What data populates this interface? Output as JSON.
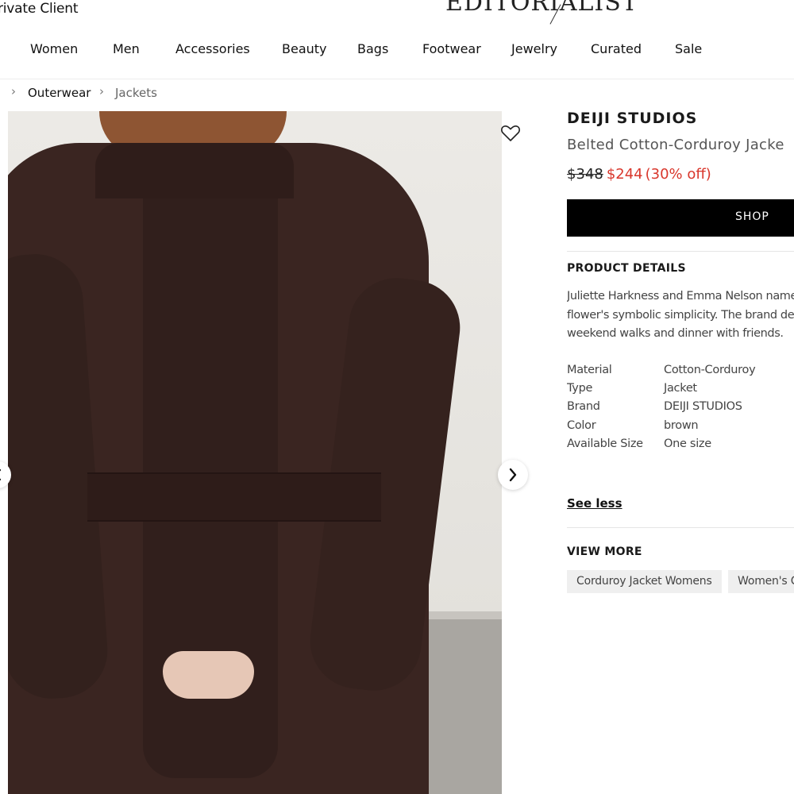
{
  "header": {
    "private_client": "rivate Client",
    "logo": "EDITORIALIST"
  },
  "nav": {
    "items": [
      "Women",
      "Men",
      "Accessories",
      "Beauty",
      "Bags",
      "Footwear",
      "Jewelry",
      "Curated",
      "Sale"
    ]
  },
  "breadcrumb": {
    "items": [
      "Outerwear",
      "Jackets"
    ]
  },
  "product": {
    "brand": "DEIJI STUDIOS",
    "title": "Belted Cotton-Corduroy Jacke",
    "price_old": "$348",
    "price_new": "$244",
    "discount": "(30% off)",
    "shop_label": "SHOP",
    "details_heading": "PRODUCT DETAILS",
    "description_lines": [
      "Juliette Harkness and Emma Nelson named",
      "flower's symbolic simplicity. The brand des",
      "weekend walks and dinner with friends."
    ],
    "attributes": [
      {
        "key": "Material",
        "value": "Cotton-Corduroy"
      },
      {
        "key": "Type",
        "value": "Jacket"
      },
      {
        "key": "Brand",
        "value": "DEIJI STUDIOS"
      },
      {
        "key": "Color",
        "value": "brown"
      },
      {
        "key": "Available Size",
        "value": "One size"
      }
    ],
    "see_less": "See less",
    "view_more_heading": "VIEW MORE",
    "chips": [
      "Corduroy Jacket Womens",
      "Women's C"
    ]
  },
  "colors": {
    "sale_red": "#d9372c",
    "shop_button": "#000000",
    "jacket_brown": "#3a2521"
  },
  "icons": {
    "wishlist": "heart-outline-icon",
    "next": "chevron-right-icon",
    "prev": "chevron-left-icon",
    "breadcrumb_separator": "chevron-right-icon"
  }
}
